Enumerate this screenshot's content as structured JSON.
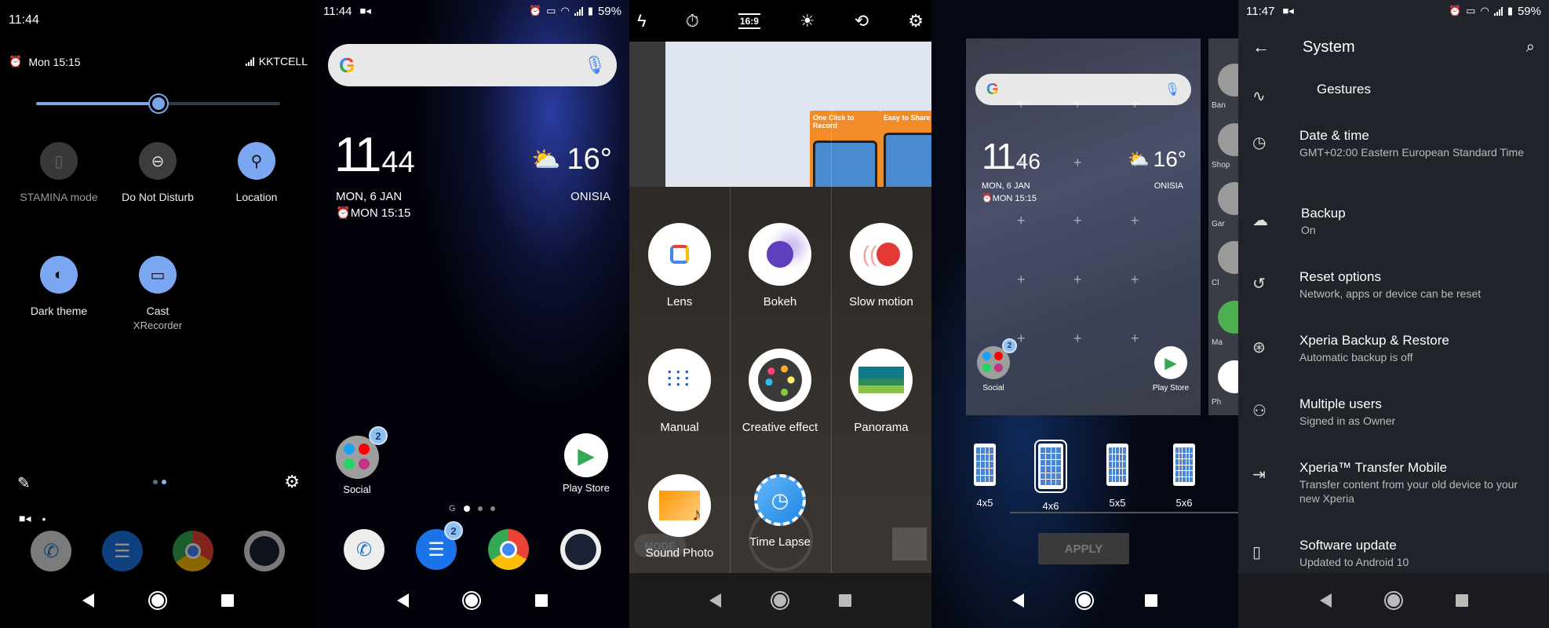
{
  "quick_settings": {
    "time": "11:44",
    "alarm": "Mon 15:15",
    "carrier": "KKTCELL",
    "brightness_level": 0.5,
    "tiles": [
      {
        "label": "STAMINA mode",
        "icon": "battery-icon",
        "state": "disabled"
      },
      {
        "label": "Do Not Disturb",
        "icon": "dnd-icon",
        "state": "off"
      },
      {
        "label": "Location",
        "icon": "location-icon",
        "state": "on"
      },
      {
        "label": "Dark theme",
        "icon": "dark-theme-icon",
        "state": "on"
      },
      {
        "label": "Cast",
        "sublabel": "XRecorder",
        "icon": "cast-icon",
        "state": "on"
      }
    ],
    "page_dots": 2,
    "active_page": 1
  },
  "home": {
    "status": {
      "time": "11:44",
      "battery": "59%"
    },
    "clock": {
      "hours": "11",
      "minutes": "44"
    },
    "date": "MON, 6 JAN",
    "alarm": "MON 15:15",
    "weather": {
      "temp": "16°",
      "city": "ONISIA"
    },
    "apps": [
      {
        "label": "Social",
        "badge": "2"
      },
      {
        "label": "Play Store"
      }
    ],
    "dock": [
      {
        "name": "Phone"
      },
      {
        "name": "Messages",
        "badge": "2"
      },
      {
        "name": "Chrome"
      },
      {
        "name": "Camera"
      }
    ],
    "page_indicator": {
      "google_label": "G",
      "pages": 3,
      "active": 0
    }
  },
  "camera": {
    "toolbar": [
      "flash-off-icon",
      "timer-off-icon",
      "aspect-ratio-icon",
      "brightness-icon",
      "switch-camera-icon",
      "settings-icon"
    ],
    "aspect_ratio": "16:9",
    "promo": [
      "One Click to Record",
      "Easy to Share &"
    ],
    "modes": [
      {
        "label": "Lens"
      },
      {
        "label": "Bokeh"
      },
      {
        "label": "Slow motion"
      },
      {
        "label": "Manual"
      },
      {
        "label": "Creative effect"
      },
      {
        "label": "Panorama"
      },
      {
        "label": "Sound Photo"
      },
      {
        "label": "Time Lapse"
      }
    ],
    "mode_button": "MODE"
  },
  "home_grid": {
    "clock": {
      "hours": "11",
      "minutes": "46"
    },
    "date": "MON, 6 JAN",
    "alarm": "MON 15:15",
    "weather": {
      "temp": "16°",
      "city": "ONISIA"
    },
    "apps": [
      {
        "label": "Social",
        "badge": "2"
      },
      {
        "label": "Play Store"
      }
    ],
    "side_folders": [
      "Ban",
      "Shop",
      "Gar",
      "Cl",
      "Ma",
      "Ph"
    ],
    "options": [
      {
        "label": "4x5",
        "cols": 4,
        "rows": 5
      },
      {
        "label": "4x6",
        "cols": 4,
        "rows": 6,
        "selected": true
      },
      {
        "label": "5x5",
        "cols": 5,
        "rows": 5
      },
      {
        "label": "5x6",
        "cols": 5,
        "rows": 6
      }
    ],
    "apply_label": "APPLY"
  },
  "settings": {
    "status": {
      "time": "11:47",
      "battery": "59%"
    },
    "title": "System",
    "items": [
      {
        "title": "Gestures",
        "subtitle": "",
        "icon": "gestures-icon"
      },
      {
        "title": "Date & time",
        "subtitle": "GMT+02:00 Eastern European Standard Time",
        "icon": "clock-icon"
      },
      {
        "title": "Backup",
        "subtitle": "On",
        "icon": "cloud-upload-icon"
      },
      {
        "title": "Reset options",
        "subtitle": "Network, apps or device can be reset",
        "icon": "history-icon"
      },
      {
        "title": "Xperia Backup & Restore",
        "subtitle": "Automatic backup is off",
        "icon": "xperia-backup-icon"
      },
      {
        "title": "Multiple users",
        "subtitle": "Signed in as Owner",
        "icon": "user-icon"
      },
      {
        "title": "Xperia™ Transfer Mobile",
        "subtitle": "Transfer content from your old device to your new Xperia",
        "icon": "transfer-icon"
      },
      {
        "title": "Software update",
        "subtitle": "Updated to Android 10",
        "icon": "system-update-icon"
      }
    ]
  }
}
